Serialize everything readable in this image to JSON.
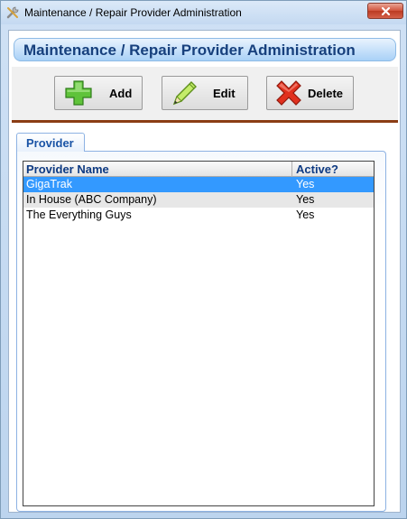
{
  "window": {
    "title": "Maintenance / Repair Provider Administration"
  },
  "header": {
    "title": "Maintenance / Repair Provider Administration"
  },
  "toolbar": {
    "add_label": "Add",
    "edit_label": "Edit",
    "delete_label": "Delete"
  },
  "tabs": [
    {
      "label": "Provider"
    }
  ],
  "grid": {
    "columns": [
      "Provider Name",
      "Active?"
    ],
    "rows": [
      {
        "name": "GigaTrak",
        "active": "Yes",
        "selected": true
      },
      {
        "name": "In House (ABC Company)",
        "active": "Yes",
        "selected": false
      },
      {
        "name": "The Everything Guys",
        "active": "Yes",
        "selected": false
      }
    ]
  },
  "colors": {
    "selection": "#3399ff",
    "header_text": "#17407d",
    "tab_text": "#1a54a6",
    "toolbar_divider": "#8b3d14"
  },
  "icons": {
    "window": "tools-icon",
    "close": "close-icon",
    "add": "plus-icon",
    "edit": "pencil-icon",
    "delete": "red-x-icon"
  }
}
